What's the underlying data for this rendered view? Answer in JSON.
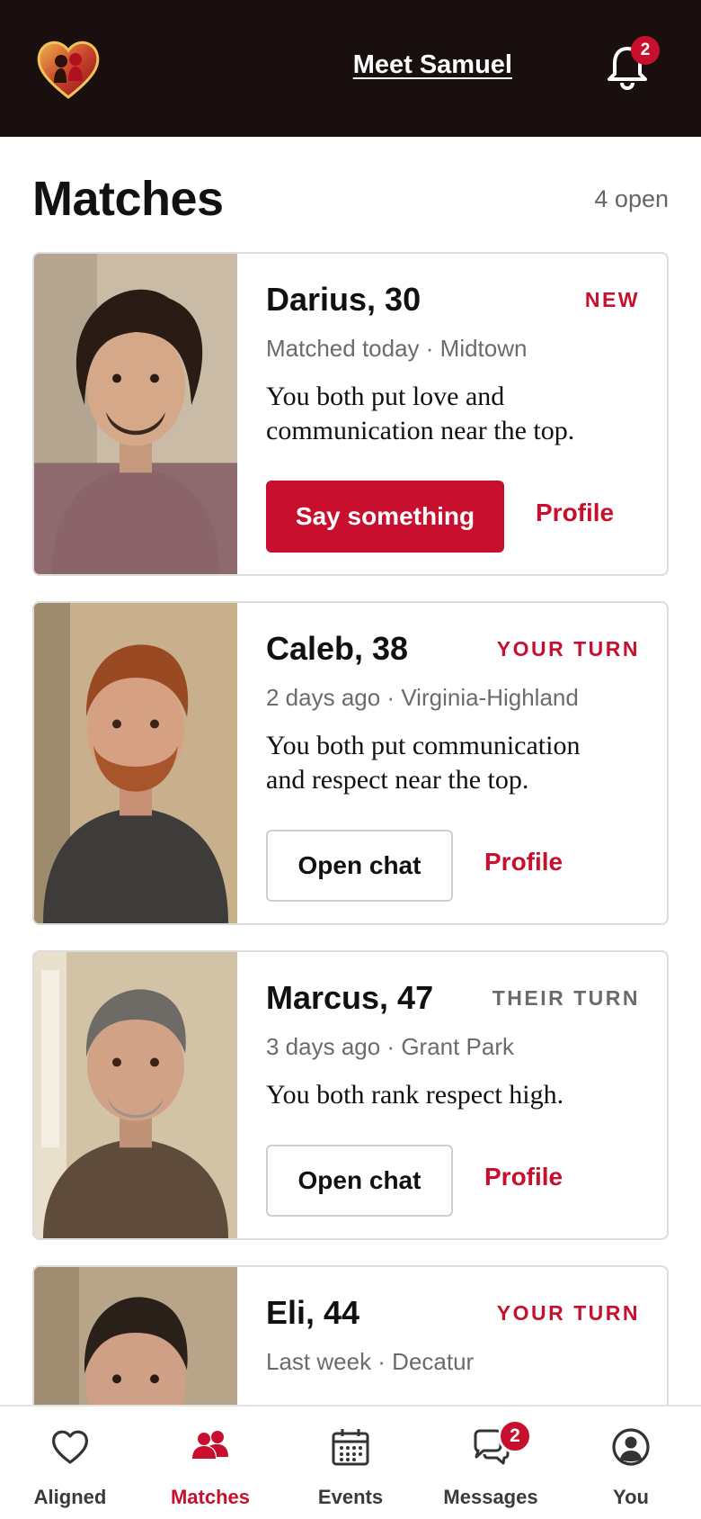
{
  "header": {
    "logo_icon": "heart-couple-logo-icon",
    "link_label": "Meet Samuel",
    "notifications_count": "2"
  },
  "section": {
    "title": "Matches",
    "open_count": "4 open"
  },
  "colors": {
    "accent": "#c8102e",
    "header_bg": "#1a0f0f",
    "muted_status": "#6b6b6b"
  },
  "matches": [
    {
      "name": "Darius, 30",
      "status": "NEW",
      "status_color": "#c8102e",
      "meta": "Matched today · Midtown",
      "blurb": "You both put love and communication near the top.",
      "action": "Say something",
      "action_style": "primary",
      "profile": "Profile"
    },
    {
      "name": "Caleb, 38",
      "status": "YOUR TURN",
      "status_color": "#c8102e",
      "meta": "2 days ago · Virginia-Highland",
      "blurb": "You both put communication and respect near the top.",
      "action": "Open chat",
      "action_style": "outline",
      "profile": "Profile"
    },
    {
      "name": "Marcus, 47",
      "status": "THEIR TURN",
      "status_color": "#6b6b6b",
      "meta": "3 days ago · Grant Park",
      "blurb": "You both rank respect high.",
      "action": "Open chat",
      "action_style": "outline",
      "profile": "Profile"
    },
    {
      "name": "Eli, 44",
      "status": "YOUR TURN",
      "status_color": "#c8102e",
      "meta": "Last week · Decatur"
    }
  ],
  "nav": [
    {
      "label": "Aligned",
      "icon": "heart-icon"
    },
    {
      "label": "Matches",
      "icon": "people-icon",
      "active": true
    },
    {
      "label": "Events",
      "icon": "calendar-icon"
    },
    {
      "label": "Messages",
      "icon": "chat-bubbles-icon",
      "badge": "2"
    },
    {
      "label": "You",
      "icon": "user-circle-icon"
    }
  ]
}
